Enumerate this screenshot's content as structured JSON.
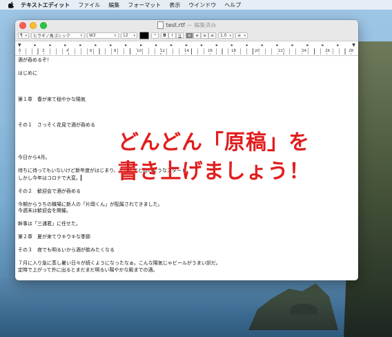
{
  "menubar": {
    "apple": "",
    "app_name": "テキストエディット",
    "items": [
      "ファイル",
      "編集",
      "フォーマット",
      "表示",
      "ウインドウ",
      "ヘルプ"
    ]
  },
  "window": {
    "title": "test.rtf",
    "edited_suffix": "— 編集済み"
  },
  "toolbar": {
    "paragraph_style": "¶",
    "font_family": "ヒラギノ角ゴシック",
    "font_weight": "W3",
    "font_size": "12",
    "text_color": "#000000",
    "bold": "B",
    "italic": "I",
    "underline": "U",
    "line_spacing": "1.0",
    "list": "≡"
  },
  "ruler": {
    "numbers": [
      "0",
      "2",
      "4",
      "6",
      "8",
      "10",
      "12",
      "14",
      "16",
      "18",
      "20",
      "22",
      "24",
      "26",
      "28"
    ]
  },
  "document": {
    "lines": [
      "酒が呑めるぞ！",
      "はじめに",
      "第１章　春が来て穏やかな陽気",
      "その１　さっそく花見で酒が呑める",
      "今日から4月。",
      "待ちに待ってもいないけど新年度がはじまり、また去年と同じようなスタート。",
      "しかし今年はコロナで大変。",
      "その２　歓迎会で酒が呑める",
      "今期からうちの職場に新人の「片岡くん」が配属されてきました。",
      "今週末は歓迎会を開催。",
      "幹事は「三浦君」に任せた。",
      "第２章　夏が来てウキウキな季節",
      "その３　夜でも明るいから酒が飲みたくなる",
      "７月に入り急に蒸し暑い日々が続くようになったなぁ。こんな陽気じゃビールがうまい訳だ。",
      "定時で上がって外に出るとまだまだ明るい陽やかな殿までの酒。"
    ]
  },
  "overlay": {
    "line1": "どんどん「原稿」を",
    "line2": "書き上げましょう！"
  }
}
